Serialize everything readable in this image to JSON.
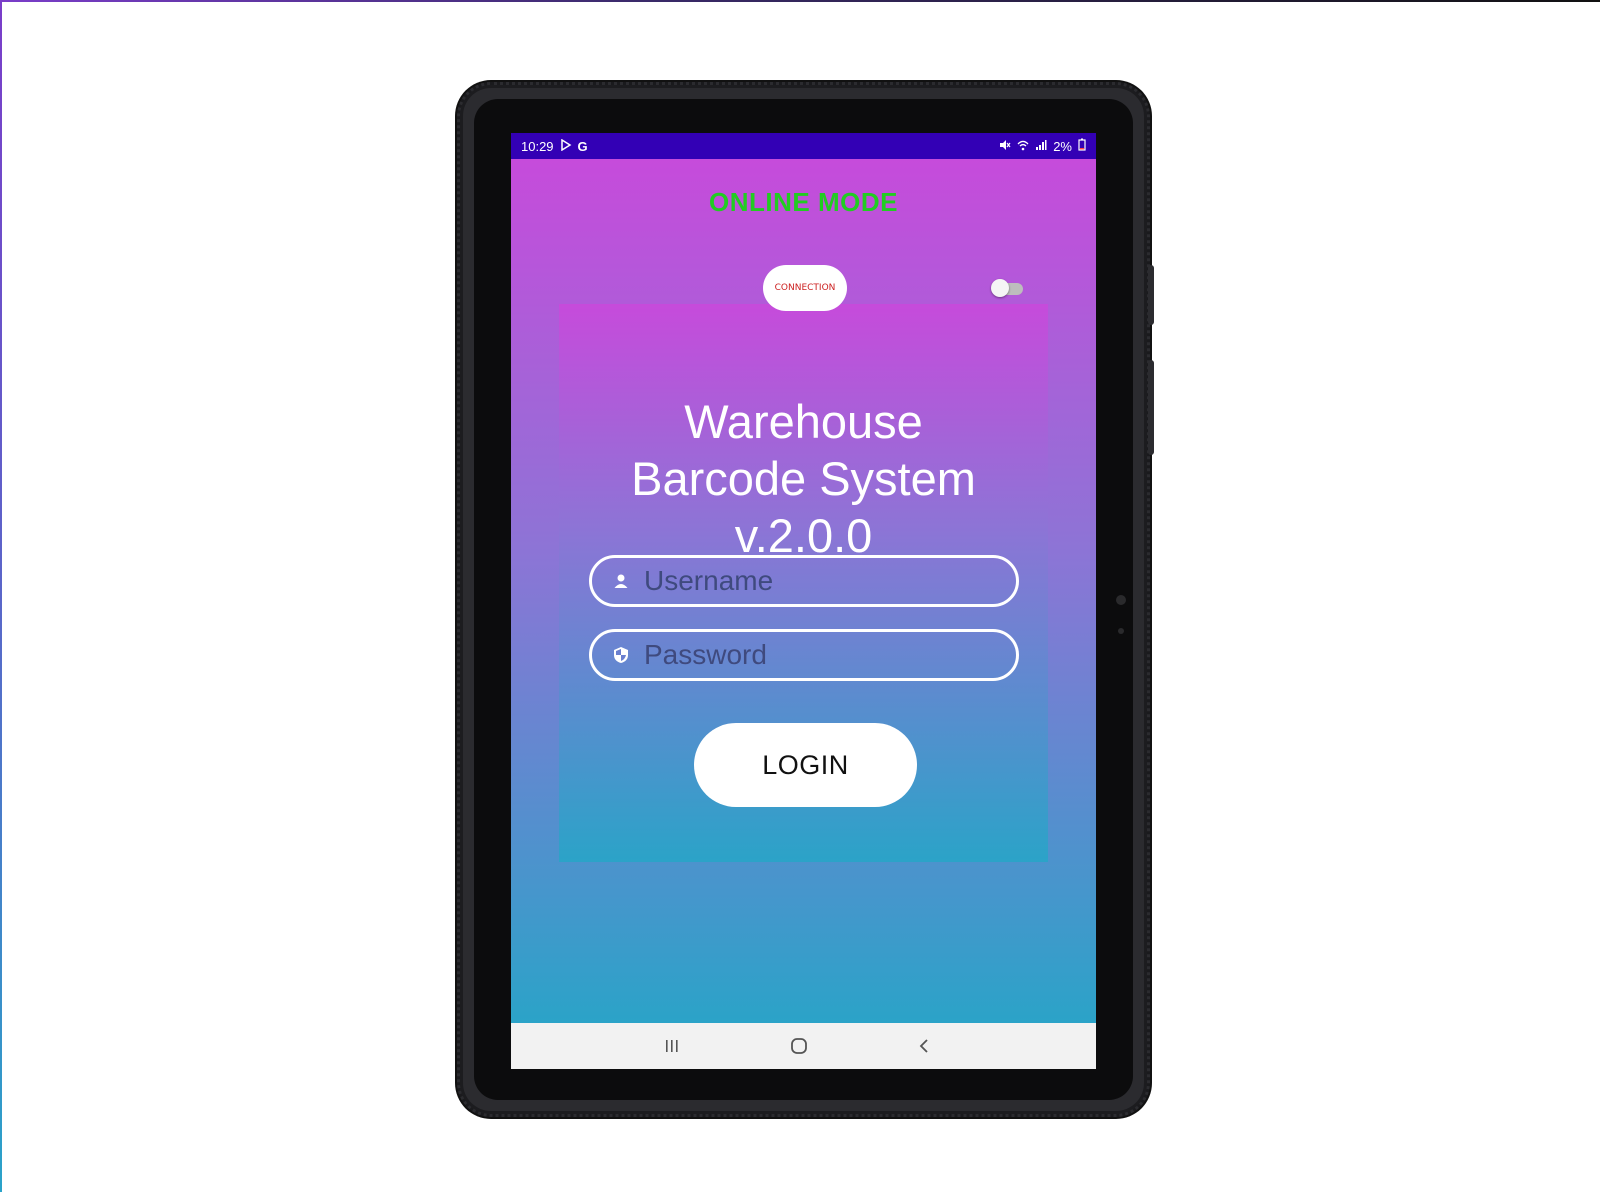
{
  "status_bar": {
    "time": "10:29",
    "left_icons": [
      "play-store-icon",
      "google-icon"
    ],
    "battery": "2%",
    "right_icons": [
      "mute-icon",
      "wifi-icon",
      "signal-icon",
      "battery-icon"
    ]
  },
  "app": {
    "mode_label": "ONLINE MODE",
    "connection_button": "CONNECTION",
    "online_toggle_on": false,
    "title_line1": "Warehouse",
    "title_line2": "Barcode System",
    "title_line3": "v.2.0.0",
    "username": {
      "placeholder": "Username",
      "value": "",
      "icon": "person-icon"
    },
    "password": {
      "placeholder": "Password",
      "value": "",
      "icon": "shield-icon"
    },
    "login_button": "LOGIN"
  },
  "nav_bar": {
    "buttons": [
      "recents-icon",
      "home-icon",
      "back-icon"
    ]
  },
  "colors": {
    "status_bar": "#3300b5",
    "gradient_top": "#c64bdb",
    "gradient_bottom": "#2ba3c8",
    "mode_label": "#22cc22",
    "connection_text": "#cc1f1f"
  }
}
